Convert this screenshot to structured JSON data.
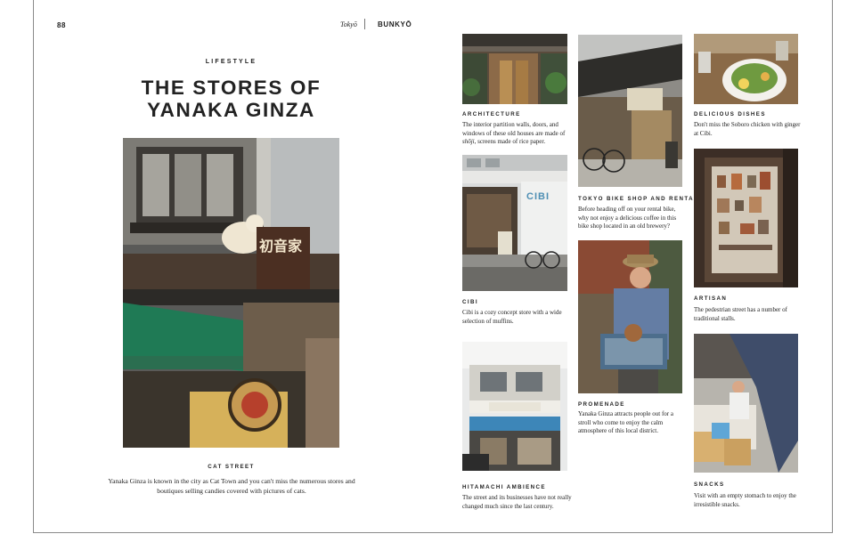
{
  "header": {
    "page_number": "88",
    "city": "Tokyō",
    "area": "BUNKYŌ"
  },
  "article": {
    "kicker": "LIFESTYLE",
    "title_line1": "THE STORES OF",
    "title_line2": "YANAKA GINZA"
  },
  "main_photo": {
    "caption_title": "CAT STREET",
    "caption_text": "Yanaka Ginza is known in the city as Cat Town and you can't miss the numerous stores and boutiques selling candies covered with pictures of cats.",
    "sign_text": "初音家"
  },
  "captions": {
    "architecture": {
      "title": "ARCHITECTURE",
      "text_before": "The interior partition walls, doors, and windows of these old houses are made of ",
      "text_italic": "shōji",
      "text_after": ", screens made of rice paper."
    },
    "cibi": {
      "title": "CIBI",
      "text": "Cibi is a cozy concept store with a wide selection of muffins.",
      "sign": "CIBI"
    },
    "hitamachi": {
      "title": "HITAMACHI AMBIENCE",
      "text": "The street and its businesses have not really changed much since the last century."
    },
    "bike_shop": {
      "title": "TOKYO BIKE SHOP AND RENTAL",
      "text": "Before heading off on your rental bike, why not enjoy a delicious coffee in this bike shop located in an old brewery?"
    },
    "promenade": {
      "title": "PROMENADE",
      "text": "Yanaka Ginza attracts people out for a stroll who come to enjoy the calm atmosphere of this local district."
    },
    "delicious": {
      "title": "DELICIOUS DISHES",
      "text": "Don't miss the Soboro chicken with ginger at Cibi."
    },
    "artisan": {
      "title": "ARTISAN",
      "text": "The pedestrian street has a number of traditional stalls."
    },
    "snacks": {
      "title": "SNACKS",
      "text": "Visit with an empty stomach to enjoy the irresistible snacks."
    }
  },
  "colors": {
    "awning_green": "#1f7a55",
    "border_gray": "#8a8a8a",
    "text": "#222222"
  }
}
